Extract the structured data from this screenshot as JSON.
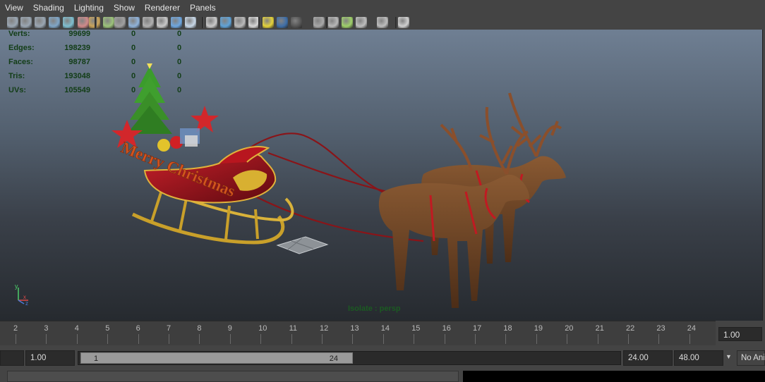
{
  "menu": [
    "View",
    "Shading",
    "Lighting",
    "Show",
    "Renderer",
    "Panels"
  ],
  "toolbar": {
    "icons": [
      {
        "name": "camera-select-icon",
        "color": "#9aa6b2"
      },
      {
        "name": "camera-lock-icon",
        "color": "#9aa6b2"
      },
      {
        "name": "bookmark-icon",
        "color": "#9aa6b2"
      },
      {
        "name": "image-plane-icon",
        "color": "#7fa6c7"
      },
      {
        "name": "grid-icon",
        "color": "#7fbfd0"
      },
      {
        "name": "film-gate-icon",
        "color": "#d08a8a"
      },
      {
        "name": "resolution-gate-icon",
        "color": "#caa45a"
      },
      {
        "name": "gate-mask-icon",
        "color": "#9cc37a"
      },
      {
        "name": "field-chart-icon",
        "color": "#a0a0a0"
      },
      {
        "name": "safe-action-icon",
        "color": "#8fb2d9"
      },
      {
        "name": "safe-title-icon",
        "color": "#b0b0b0"
      },
      {
        "name": "wireframe-icon",
        "color": "#c8c8c8"
      },
      {
        "name": "smooth-shade-icon",
        "color": "#6ea7e0"
      },
      {
        "name": "wireframe-on-shaded-icon",
        "color": "#c8d8e8"
      },
      {
        "name": "textured-icon",
        "color": "#c9c9c9"
      },
      {
        "name": "use-lights-icon",
        "color": "#5fa3d8"
      },
      {
        "name": "xray-icon",
        "color": "#bababa"
      },
      {
        "name": "default-lighting-icon",
        "color": "#d8d8d8"
      },
      {
        "name": "shadows-icon",
        "color": "#e4d23a"
      },
      {
        "name": "ambient-occlusion-icon",
        "color": "#3e6ea8"
      },
      {
        "name": "motion-blur-icon",
        "color": "#555555"
      },
      {
        "name": "anti-aliasing-icon",
        "color": "#a8a8a8"
      },
      {
        "name": "depth-of-field-icon",
        "color": "#b8b8b8"
      },
      {
        "name": "isolate-select-icon",
        "color": "#9fd06a"
      },
      {
        "name": "xray-joints-icon",
        "color": "#bdbdbd"
      },
      {
        "name": "xray-active-icon",
        "color": "#bdbdbd"
      },
      {
        "name": "component-share-icon",
        "color": "#d0d0d0"
      }
    ]
  },
  "viewport": {
    "hud": [
      {
        "label": "Verts:",
        "total": "99699",
        "selected": "0",
        "highlighted": "0"
      },
      {
        "label": "Edges:",
        "total": "198239",
        "selected": "0",
        "highlighted": "0"
      },
      {
        "label": "Faces:",
        "total": "98787",
        "selected": "0",
        "highlighted": "0"
      },
      {
        "label": "Tris:",
        "total": "193048",
        "selected": "0",
        "highlighted": "0"
      },
      {
        "label": "UVs:",
        "total": "105549",
        "selected": "0",
        "highlighted": "0"
      }
    ],
    "isolate_label": "Isolate : persp",
    "sign_text": "Merry Christmas",
    "axis": {
      "y": "y",
      "x": "x",
      "z": "z"
    }
  },
  "timeline": {
    "ticks": [
      "2",
      "3",
      "4",
      "5",
      "6",
      "7",
      "8",
      "9",
      "10",
      "11",
      "12",
      "13",
      "14",
      "15",
      "16",
      "17",
      "18",
      "19",
      "20",
      "21",
      "22",
      "23",
      "24"
    ],
    "current_frame": "1.00"
  },
  "range": {
    "start_time": "1.00",
    "slider_start": "1",
    "slider_end": "24",
    "end_time": "24.00",
    "anim_end": "48.00",
    "anim_layer": "No Anim"
  }
}
